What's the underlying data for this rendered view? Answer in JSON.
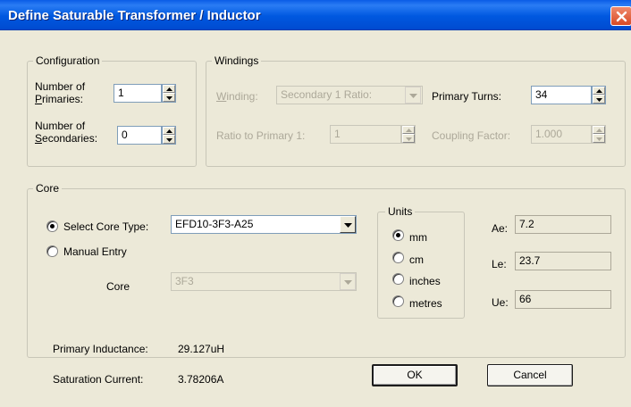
{
  "window": {
    "title": "Define Saturable Transformer / Inductor"
  },
  "configuration": {
    "legend": "Configuration",
    "num_primaries_label_line1": "Number of",
    "num_primaries_label_line2": "Primaries:",
    "num_primaries_value": "1",
    "num_secondaries_label_line1": "Number of",
    "num_secondaries_label_line2": "Secondaries:",
    "num_secondaries_value": "0"
  },
  "windings": {
    "legend": "Windings",
    "winding_label": "Winding:",
    "winding_value": "Secondary 1 Ratio:",
    "primary_turns_label": "Primary Turns:",
    "primary_turns_value": "34",
    "ratio_label": "Ratio to Primary 1:",
    "ratio_value": "1",
    "coupling_label": "Coupling Factor:",
    "coupling_value": "1.000"
  },
  "core": {
    "legend": "Core",
    "select_core_label": "Select Core Type:",
    "select_core_checked": true,
    "core_type_value": "EFD10-3F3-A25",
    "manual_entry_label": "Manual Entry",
    "manual_entry_checked": false,
    "core_label": "Core",
    "core_material_value": "3F3",
    "units": {
      "legend": "Units",
      "options": [
        {
          "label": "mm",
          "checked": true
        },
        {
          "label": "cm",
          "checked": false
        },
        {
          "label": "inches",
          "checked": false
        },
        {
          "label": "metres",
          "checked": false
        }
      ]
    },
    "ae_label": "Ae:",
    "ae_value": "7.2",
    "le_label": "Le:",
    "le_value": "23.7",
    "ue_label": "Ue:",
    "ue_value": "66"
  },
  "results": {
    "primary_inductance_label": "Primary Inductance:",
    "primary_inductance_value": "29.127uH",
    "saturation_current_label": "Saturation Current:",
    "saturation_current_value": "3.78206A"
  },
  "buttons": {
    "ok": "OK",
    "cancel": "Cancel"
  },
  "icons": {
    "close": "close-x-icon",
    "spin_up": "triangle-up-icon",
    "spin_down": "triangle-down-icon",
    "dropdown": "chevron-down-icon",
    "radio": "radio-dot-icon"
  },
  "colors": {
    "titlebar": "#0058e0",
    "close_button": "#d84a25",
    "dialog_bg": "#ece9d8"
  }
}
